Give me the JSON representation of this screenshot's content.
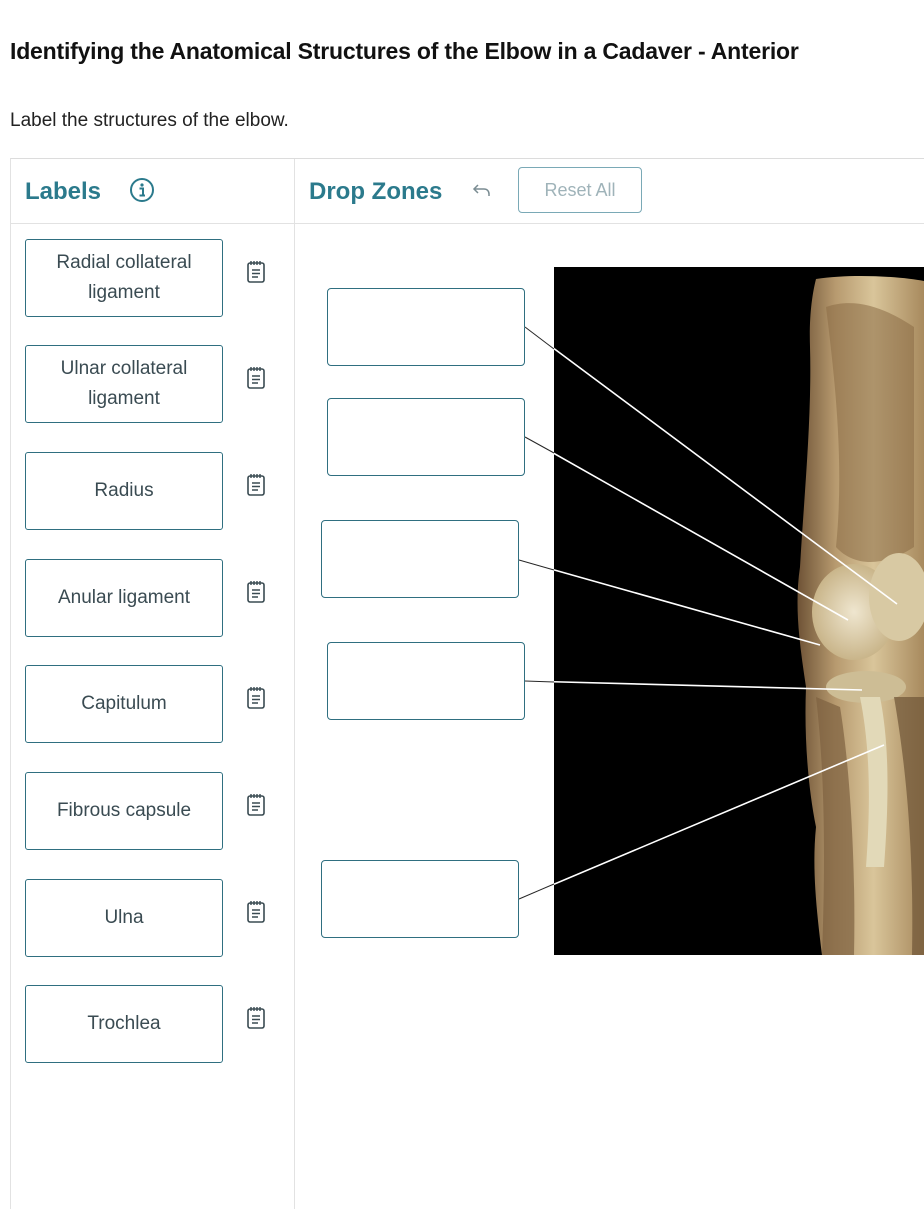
{
  "page": {
    "title": "Identifying the Anatomical Structures of the Elbow in a Cadaver - Anterior",
    "instruction": "Label the structures of the elbow."
  },
  "labels_panel": {
    "title": "Labels",
    "info_icon": "info-circle-icon",
    "hint_icon": "notepad-icon",
    "items": [
      {
        "label": "Radial collateral ligament"
      },
      {
        "label": "Ulnar collateral ligament"
      },
      {
        "label": "Radius"
      },
      {
        "label": "Anular ligament"
      },
      {
        "label": "Capitulum"
      },
      {
        "label": "Fibrous capsule"
      },
      {
        "label": "Ulna"
      },
      {
        "label": "Trochlea"
      }
    ]
  },
  "drop_zones": {
    "title": "Drop Zones",
    "undo_icon": "undo-arrow-icon",
    "reset_label": "Reset All",
    "zones": [
      {
        "value": ""
      },
      {
        "value": ""
      },
      {
        "value": ""
      },
      {
        "value": ""
      },
      {
        "value": ""
      }
    ]
  },
  "colors": {
    "accent": "#2b7a8c",
    "border": "#2f6f80",
    "muted_button_text": "#9fb3b9"
  }
}
